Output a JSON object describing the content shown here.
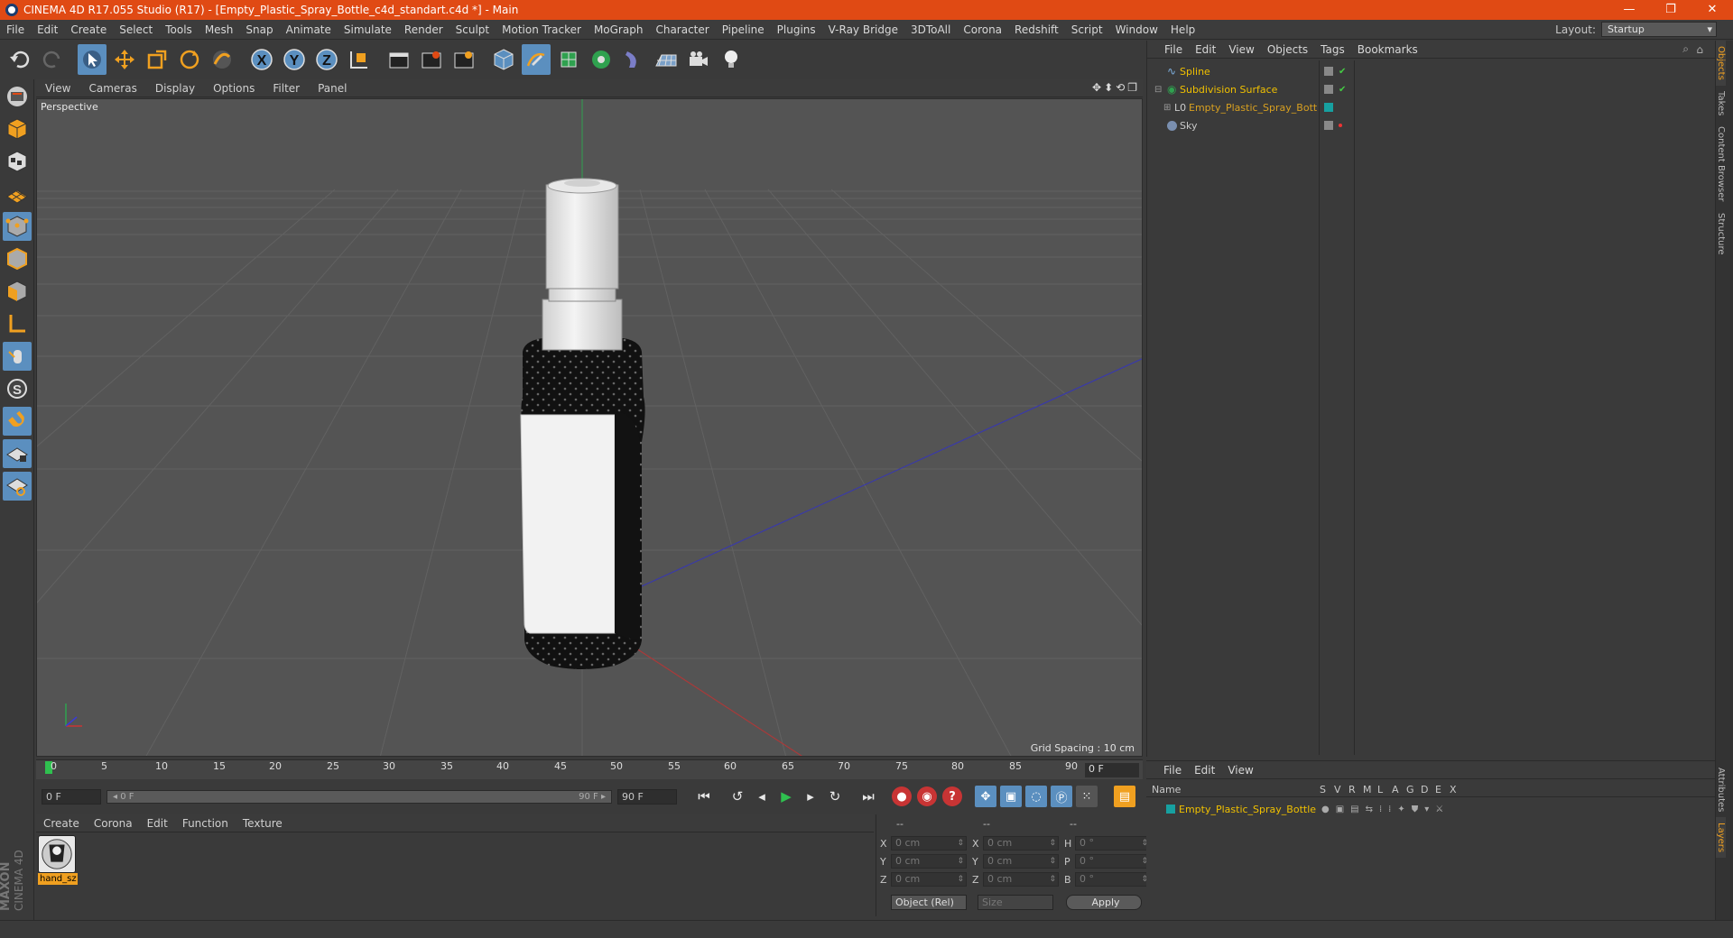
{
  "window": {
    "title": "CINEMA 4D R17.055 Studio (R17) - [Empty_Plastic_Spray_Bottle_c4d_standart.c4d *] - Main",
    "minimize": "—",
    "restore": "❐",
    "close": "✕"
  },
  "menu": [
    "File",
    "Edit",
    "Create",
    "Select",
    "Tools",
    "Mesh",
    "Snap",
    "Animate",
    "Simulate",
    "Render",
    "Sculpt",
    "Motion Tracker",
    "MoGraph",
    "Character",
    "Pipeline",
    "Plugins",
    "V-Ray Bridge",
    "3DToAll",
    "Corona",
    "Redshift",
    "Script",
    "Window",
    "Help"
  ],
  "layout": {
    "label": "Layout:",
    "value": "Startup"
  },
  "toolbar_icons": [
    "undo-icon",
    "redo-icon",
    "select-arrow-icon",
    "move-icon",
    "scale-icon",
    "rotate-icon",
    "live-select-icon",
    "x-axis-icon",
    "y-axis-icon",
    "z-axis-icon",
    "coordinate-system-icon",
    "render-view-icon",
    "render-picture-viewer-icon",
    "render-settings-icon",
    "cube-icon",
    "pen-spline-icon",
    "subdivision-icon",
    "array-icon",
    "deformer-icon",
    "floor-icon",
    "camera-icon",
    "light-icon"
  ],
  "axis_labels": {
    "x": "X",
    "y": "Y",
    "z": "Z"
  },
  "viewport": {
    "menu": [
      "View",
      "Cameras",
      "Display",
      "Options",
      "Filter",
      "Panel"
    ],
    "label": "Perspective",
    "grid_spacing": "Grid Spacing : 10 cm"
  },
  "timeline": {
    "ticks": [
      "0",
      "5",
      "10",
      "15",
      "20",
      "25",
      "30",
      "35",
      "40",
      "45",
      "50",
      "55",
      "60",
      "65",
      "70",
      "75",
      "80",
      "85",
      "90"
    ],
    "current_frame": "0 F"
  },
  "transport": {
    "start": "0 F",
    "slider_left": "◂ 0 F",
    "slider_right": "90 F ▸",
    "end": "90 F"
  },
  "material_menu": [
    "Create",
    "Corona",
    "Edit",
    "Function",
    "Texture"
  ],
  "material": {
    "name": "hand_sz"
  },
  "coords": {
    "headers": [
      "--",
      "--",
      "--"
    ],
    "rows": [
      {
        "a": "X",
        "av": "0 cm",
        "b": "X",
        "bv": "0 cm",
        "c": "H",
        "cv": "0 °"
      },
      {
        "a": "Y",
        "av": "0 cm",
        "b": "Y",
        "bv": "0 cm",
        "c": "P",
        "cv": "0 °"
      },
      {
        "a": "Z",
        "av": "0 cm",
        "b": "Z",
        "bv": "0 cm",
        "c": "B",
        "cv": "0 °"
      }
    ],
    "mode": "Object (Rel)",
    "size": "Size",
    "apply": "Apply"
  },
  "objects_menu": [
    "File",
    "Edit",
    "View",
    "Objects",
    "Tags",
    "Bookmarks"
  ],
  "objects": [
    {
      "name": "Spline",
      "color": "#f0c000"
    },
    {
      "name": "Subdivision Surface",
      "color": "#f0c000"
    },
    {
      "name": "Empty_Plastic_Spray_Bottle",
      "color": "#d8a020"
    },
    {
      "name": "Sky",
      "color": "#c8c8c8"
    }
  ],
  "layers_menu": [
    "File",
    "Edit",
    "View"
  ],
  "layers_header": {
    "name": "Name",
    "cols": [
      "S",
      "V",
      "R",
      "M",
      "L",
      "A",
      "G",
      "D",
      "E",
      "X"
    ]
  },
  "layer": {
    "name": "Empty_Plastic_Spray_Bottle"
  },
  "side_tabs": [
    "Objects",
    "Takes",
    "Content Browser",
    "Structure"
  ],
  "side_tabs_bottom": [
    "Attributes",
    "Layers"
  ],
  "brand": {
    "line1": "MAXON",
    "line2": "CINEMA 4D"
  },
  "colors": {
    "accent": "#e04a14",
    "selection": "#5b8fbf",
    "object_name": "#f0c000"
  }
}
